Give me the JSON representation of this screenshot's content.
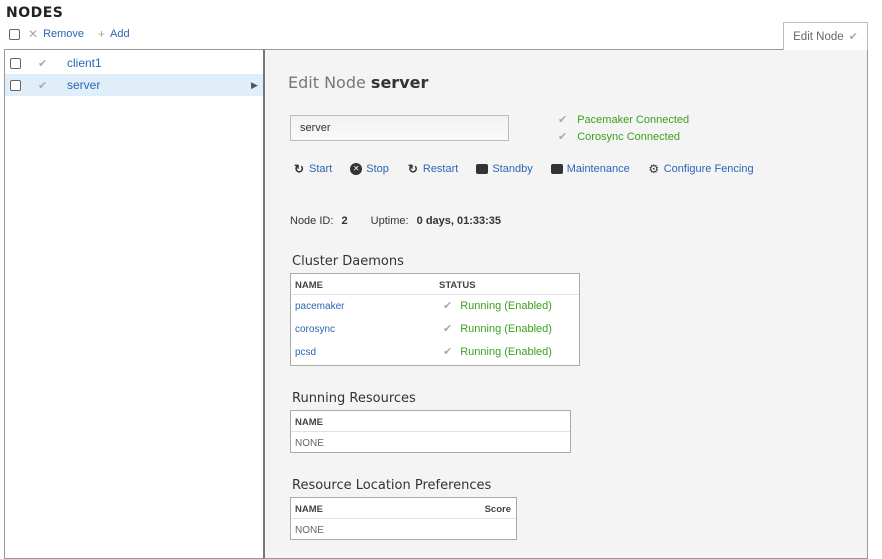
{
  "page": {
    "title": "NODES"
  },
  "toolbar": {
    "remove_label": "Remove",
    "add_label": "Add"
  },
  "tab": {
    "label": "Edit Node"
  },
  "nodes": [
    {
      "name": "client1",
      "selected": false
    },
    {
      "name": "server",
      "selected": true
    }
  ],
  "edit": {
    "title_prefix": "Edit Node",
    "node_name": "server",
    "input_value": "server",
    "status": [
      "Pacemaker Connected",
      "Corosync Connected"
    ],
    "actions": [
      "Start",
      "Stop",
      "Restart",
      "Standby",
      "Maintenance",
      "Configure Fencing"
    ],
    "node_id_label": "Node ID:",
    "node_id": "2",
    "uptime_label": "Uptime:",
    "uptime": "0 days, 01:33:35"
  },
  "daemons": {
    "title": "Cluster Daemons",
    "col_name": "NAME",
    "col_status": "STATUS",
    "rows": [
      {
        "name": "pacemaker",
        "status": "Running (Enabled)"
      },
      {
        "name": "corosync",
        "status": "Running (Enabled)"
      },
      {
        "name": "pcsd",
        "status": "Running (Enabled)"
      }
    ]
  },
  "resources": {
    "title": "Running Resources",
    "col_name": "NAME",
    "empty": "NONE"
  },
  "locations": {
    "title": "Resource Location Preferences",
    "col_name": "NAME",
    "col_score": "Score",
    "empty": "NONE"
  },
  "colors": {
    "link": "#2a66b5",
    "ok": "#3ca01e",
    "selected_row": "#e0eef9"
  },
  "icons": {
    "check": "check-icon",
    "remove": "x-icon",
    "add": "plus-icon"
  }
}
